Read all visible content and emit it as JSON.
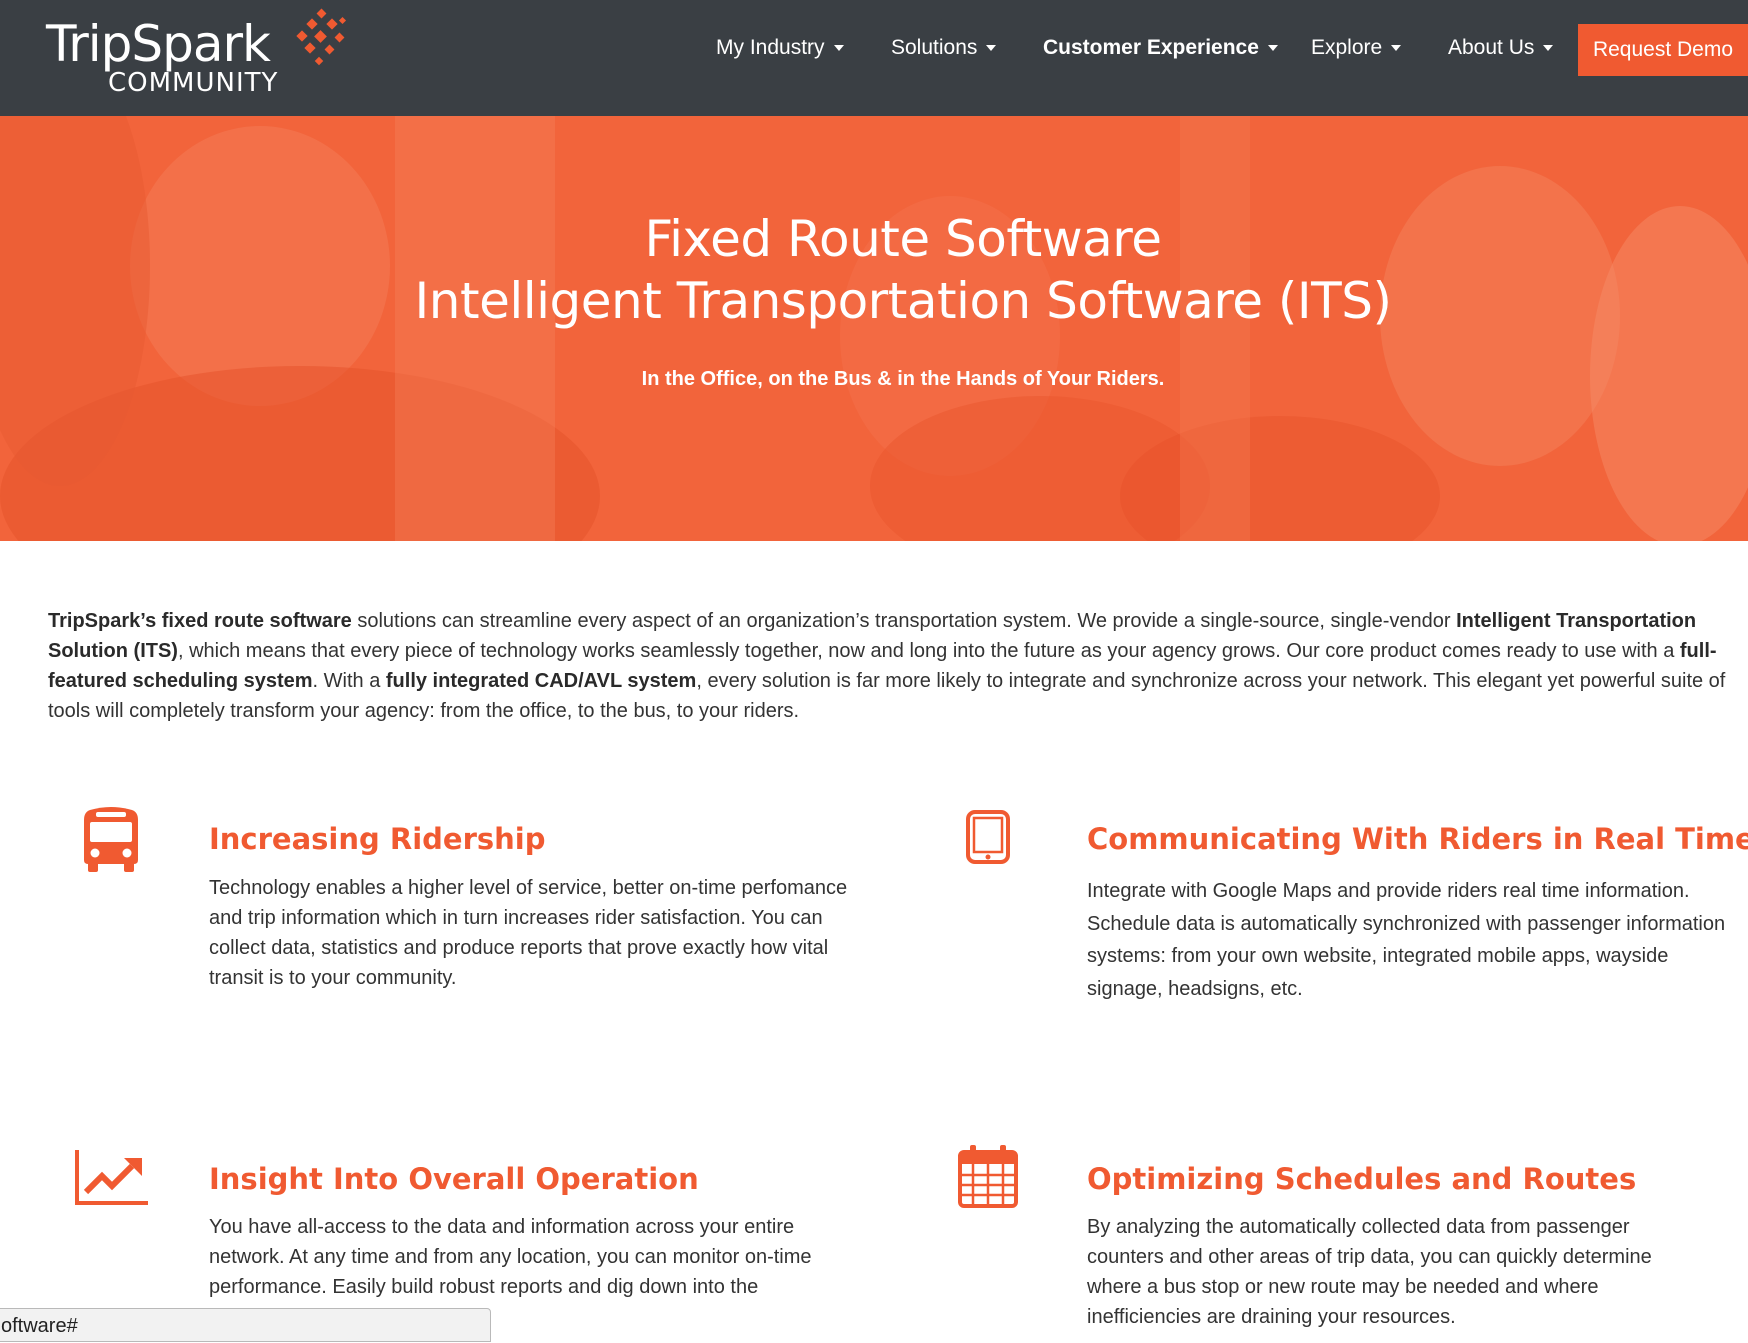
{
  "brand": {
    "name": "TripSpark",
    "subtitle": "COMMUNITY",
    "accent": "#f05a31",
    "header_bg": "#3a3f44"
  },
  "nav": {
    "items": [
      {
        "label": "My Industry",
        "weight": "normal"
      },
      {
        "label": "Solutions",
        "weight": "normal"
      },
      {
        "label": "Customer Experience",
        "weight": "bold"
      },
      {
        "label": "Explore",
        "weight": "normal"
      },
      {
        "label": "About Us",
        "weight": "normal"
      }
    ],
    "cta": "Request Demo"
  },
  "hero": {
    "title_line1": "Fixed Route Software",
    "title_line2": "Intelligent Transportation Software (ITS)",
    "subtitle": "In the Office, on the Bus & in the Hands of Your Riders."
  },
  "intro": {
    "segments": [
      {
        "text": "TripSpark’s fixed route software",
        "bold": true
      },
      {
        "text": " solutions can streamline every aspect of an organization’s transportation system. We provide a single-source, single-vendor ",
        "bold": false
      },
      {
        "text": "Intelligent Transportation Solution (ITS)",
        "bold": true
      },
      {
        "text": ", which means that every piece of technology works seamlessly together, now and long into the future as your agency grows. Our core product comes ready to use with a ",
        "bold": false
      },
      {
        "text": "full-featured scheduling system",
        "bold": true
      },
      {
        "text": ". With a ",
        "bold": false
      },
      {
        "text": "fully integrated CAD/AVL system",
        "bold": true
      },
      {
        "text": ", every solution is far more likely to integrate and synchronize across your network. This elegant yet powerful suite of tools will completely transform your agency: from the office, to the bus, to your riders.",
        "bold": false
      }
    ]
  },
  "features": [
    {
      "icon": "bus-icon",
      "title": "Increasing Ridership",
      "body": "Technology enables a higher level of service, better on-time perfomance and trip information which in turn increases rider satisfaction. You can collect data, statistics and produce reports that prove exactly how vital transit is to your community."
    },
    {
      "icon": "tablet-icon",
      "title": "Communicating With Riders in Real Time",
      "body": "Integrate with Google Maps and provide riders real time information. Schedule data is automatically synchronized with passenger information systems: from your own website, integrated mobile apps, wayside signage, headsigns, etc."
    },
    {
      "icon": "line-chart-icon",
      "title": "Insight Into Overall Operation",
      "body": "You have all-access to the data and information across your entire network. At any time and from any location, you can monitor on-time performance. Easily build robust reports and dig down into the"
    },
    {
      "icon": "calendar-icon",
      "title": "Optimizing Schedules and Routes",
      "body": "By analyzing the automatically collected data from passenger counters and other areas of trip data, you can quickly determine where a bus stop or new route may be needed and where inefficiencies are draining your resources."
    }
  ],
  "status_bar": {
    "url_text": "oftware#"
  }
}
